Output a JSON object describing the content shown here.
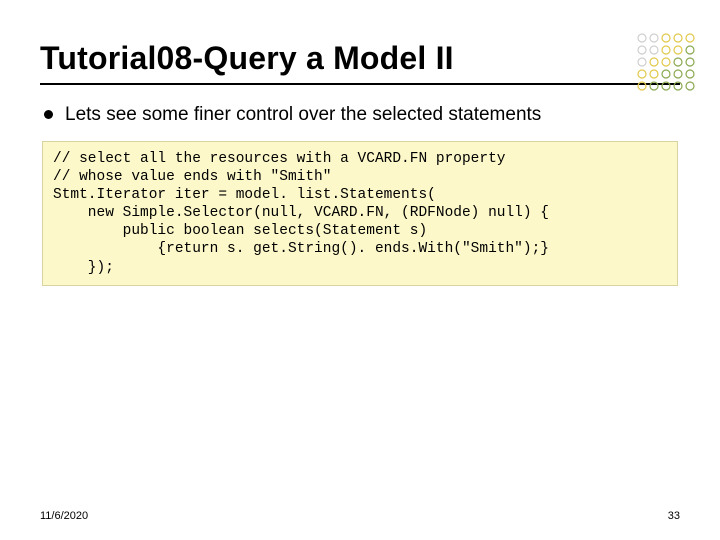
{
  "title": "Tutorial08-Query a Model II",
  "bullet": "Lets see some finer control over the selected statements",
  "code": {
    "l1": "// select all the resources with a VCARD.FN property",
    "l2": "// whose value ends with \"Smith\"",
    "l3": "Stmt.Iterator iter = model. list.Statements(",
    "l4": "    new Simple.Selector(null, VCARD.FN, (RDFNode) null) {",
    "l5": "        public boolean selects(Statement s)",
    "l6": "            {return s. get.String(). ends.With(\"Smith\");}",
    "l7": "    });"
  },
  "footer": {
    "date": "11/6/2020",
    "page": "33"
  }
}
